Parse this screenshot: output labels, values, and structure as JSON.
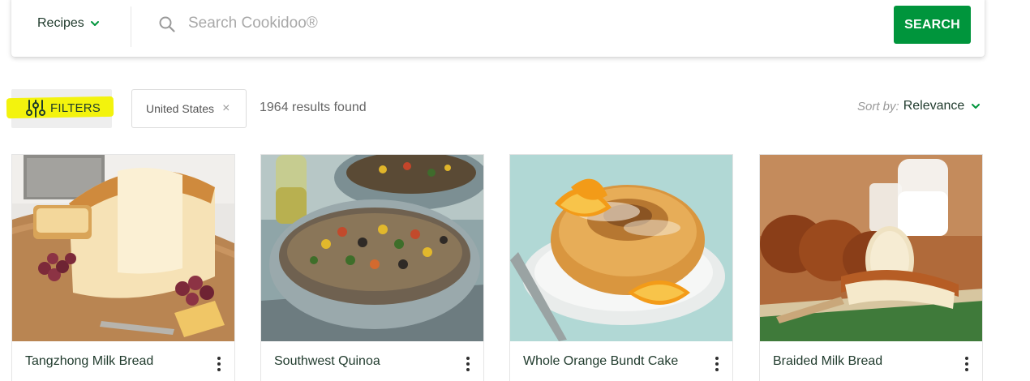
{
  "search": {
    "category": "Recipes",
    "placeholder": "Search Cookidoo®",
    "button_label": "SEARCH"
  },
  "filters": {
    "button_label": "FILTERS",
    "active_chip": "United States",
    "results_text": "1964 results found",
    "sort_prefix": "Sort by:",
    "sort_value": "Relevance"
  },
  "recipes": [
    {
      "title": "Tangzhong Milk Bread"
    },
    {
      "title": "Southwest Quinoa"
    },
    {
      "title": "Whole Orange Bundt Cake"
    },
    {
      "title": "Braided Milk Bread"
    }
  ],
  "colors": {
    "accent": "#00953c",
    "highlight": "#f2f200",
    "text_dark": "#1f3a2c"
  }
}
